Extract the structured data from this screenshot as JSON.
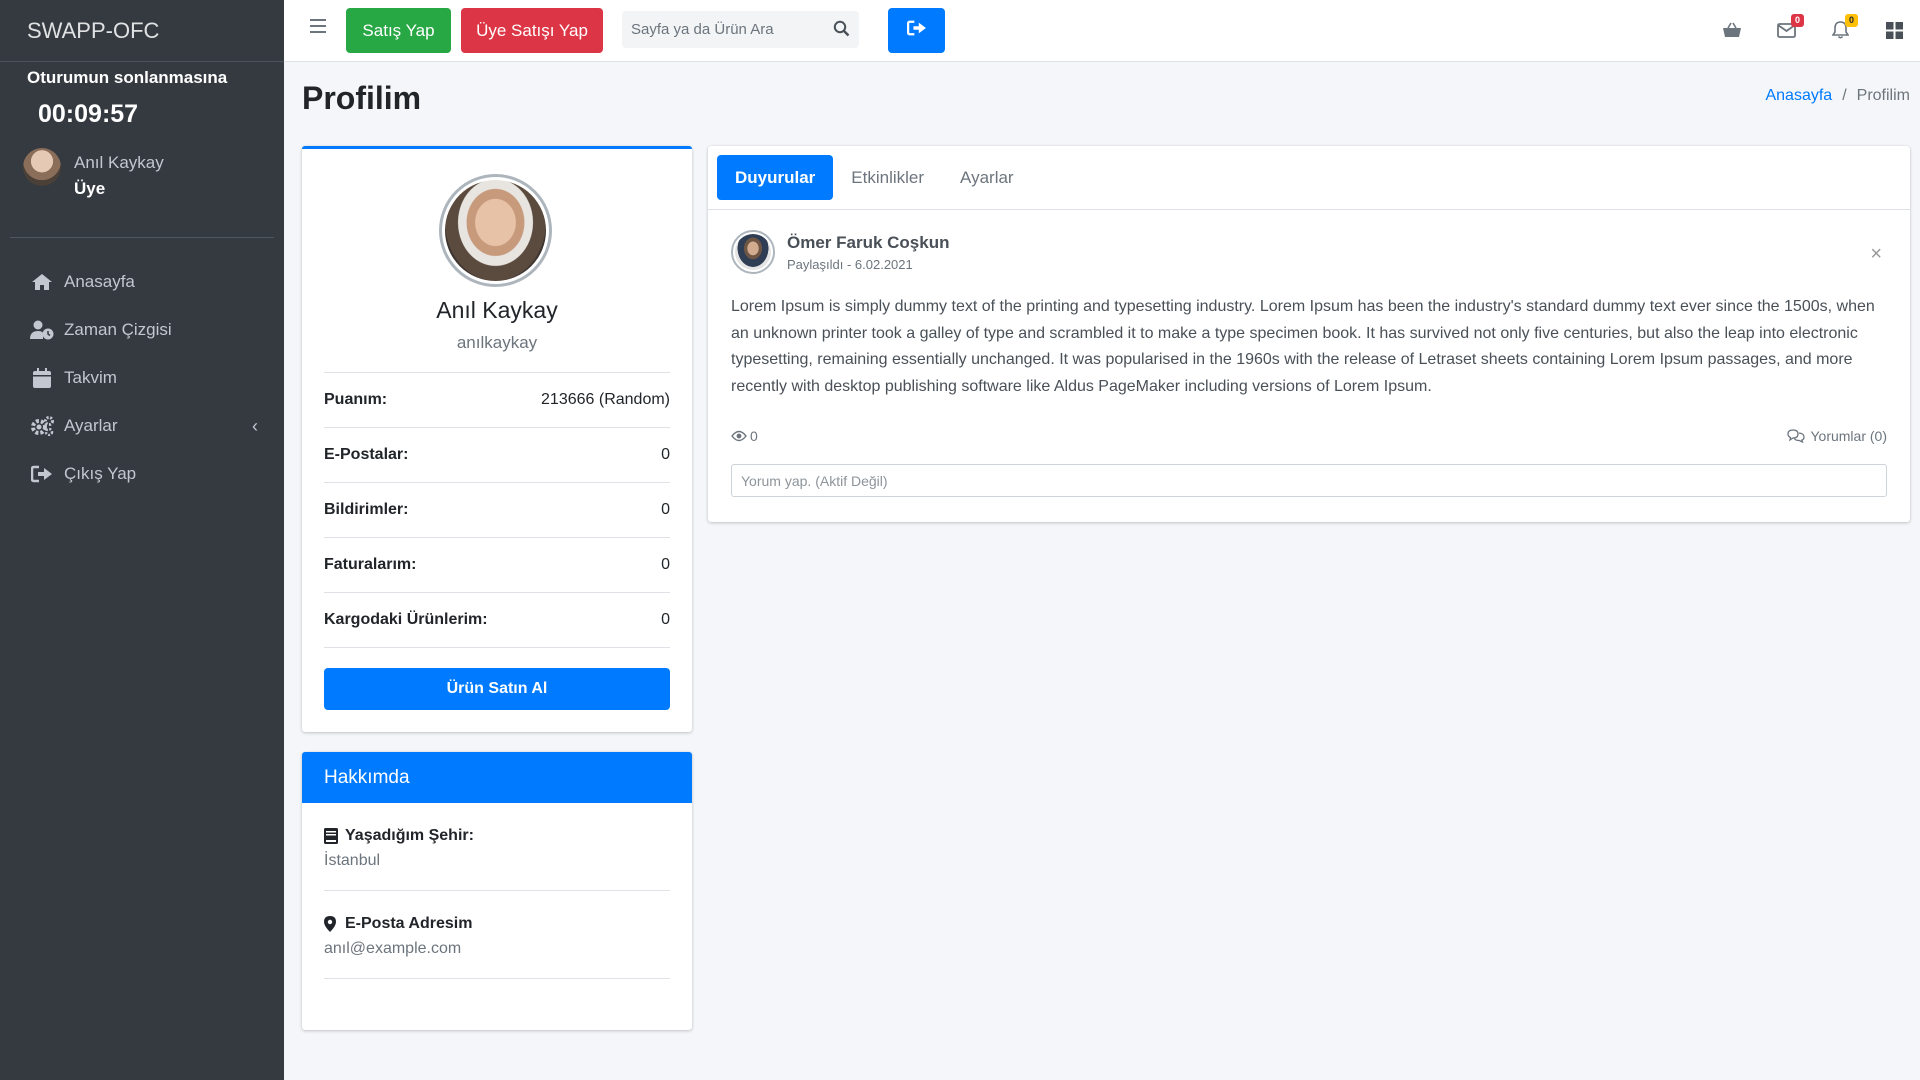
{
  "app": {
    "brand": "SWAPP-OFC"
  },
  "session": {
    "label": "Oturumun sonlanmasına",
    "timer": "00:09:57"
  },
  "sidebar_user": {
    "name": "Anıl Kaykay",
    "role": "Üye"
  },
  "sidebar": {
    "items": [
      {
        "label": "Anasayfa",
        "icon": "home-icon"
      },
      {
        "label": "Zaman Çizgisi",
        "icon": "users-clock-icon"
      },
      {
        "label": "Takvim",
        "icon": "calendar-icon"
      },
      {
        "label": "Ayarlar",
        "icon": "cogs-icon"
      },
      {
        "label": "Çıkış Yap",
        "icon": "sign-out-icon"
      }
    ]
  },
  "topbar": {
    "sale_label": "Satış Yap",
    "member_sale_label": "Üye Satışı Yap",
    "search_placeholder": "Sayfa ya da Ürün Ara",
    "mail_badge": "0",
    "notif_badge": "0"
  },
  "page": {
    "title": "Profilim"
  },
  "breadcrumb": {
    "home": "Anasayfa",
    "current": "Profilim"
  },
  "profile": {
    "name": "Anıl Kaykay",
    "username": "anılkaykay",
    "stats": [
      {
        "label": "Puanım:",
        "value": "213666 (Random)"
      },
      {
        "label": "E-Postalar:",
        "value": "0"
      },
      {
        "label": "Bildirimler:",
        "value": "0"
      },
      {
        "label": "Faturalarım:",
        "value": "0"
      },
      {
        "label": "Kargodaki Ürünlerim:",
        "value": "0"
      }
    ],
    "buy_label": "Ürün Satın Al"
  },
  "about": {
    "title": "Hakkımda",
    "city_label": "Yaşadığım Şehir:",
    "city_value": "İstanbul",
    "email_label": "E-Posta Adresim",
    "email_value": "anıl@example.com"
  },
  "tabs": [
    {
      "label": "Duyurular",
      "active": true
    },
    {
      "label": "Etkinlikler",
      "active": false
    },
    {
      "label": "Ayarlar",
      "active": false
    }
  ],
  "post": {
    "author": "Ömer Faruk Coşkun",
    "meta": "Paylaşıldı - 6.02.2021",
    "text": "Lorem Ipsum is simply dummy text of the printing and typesetting industry. Lorem Ipsum has been the industry's standard dummy text ever since the 1500s, when an unknown printer took a galley of type and scrambled it to make a type specimen book. It has survived not only five centuries, but also the leap into electronic typesetting, remaining essentially unchanged. It was popularised in the 1960s with the release of Letraset sheets containing Lorem Ipsum passages, and more recently with desktop publishing software like Aldus PageMaker including versions of Lorem Ipsum.",
    "views": "0",
    "comments_label": "Yorumlar (0)",
    "comment_placeholder": "Yorum yap. (Aktif Değil)"
  },
  "colors": {
    "primary": "#007bff",
    "success": "#28a745",
    "danger": "#dc3545",
    "warning": "#ffc107",
    "sidebar": "#343a40"
  }
}
